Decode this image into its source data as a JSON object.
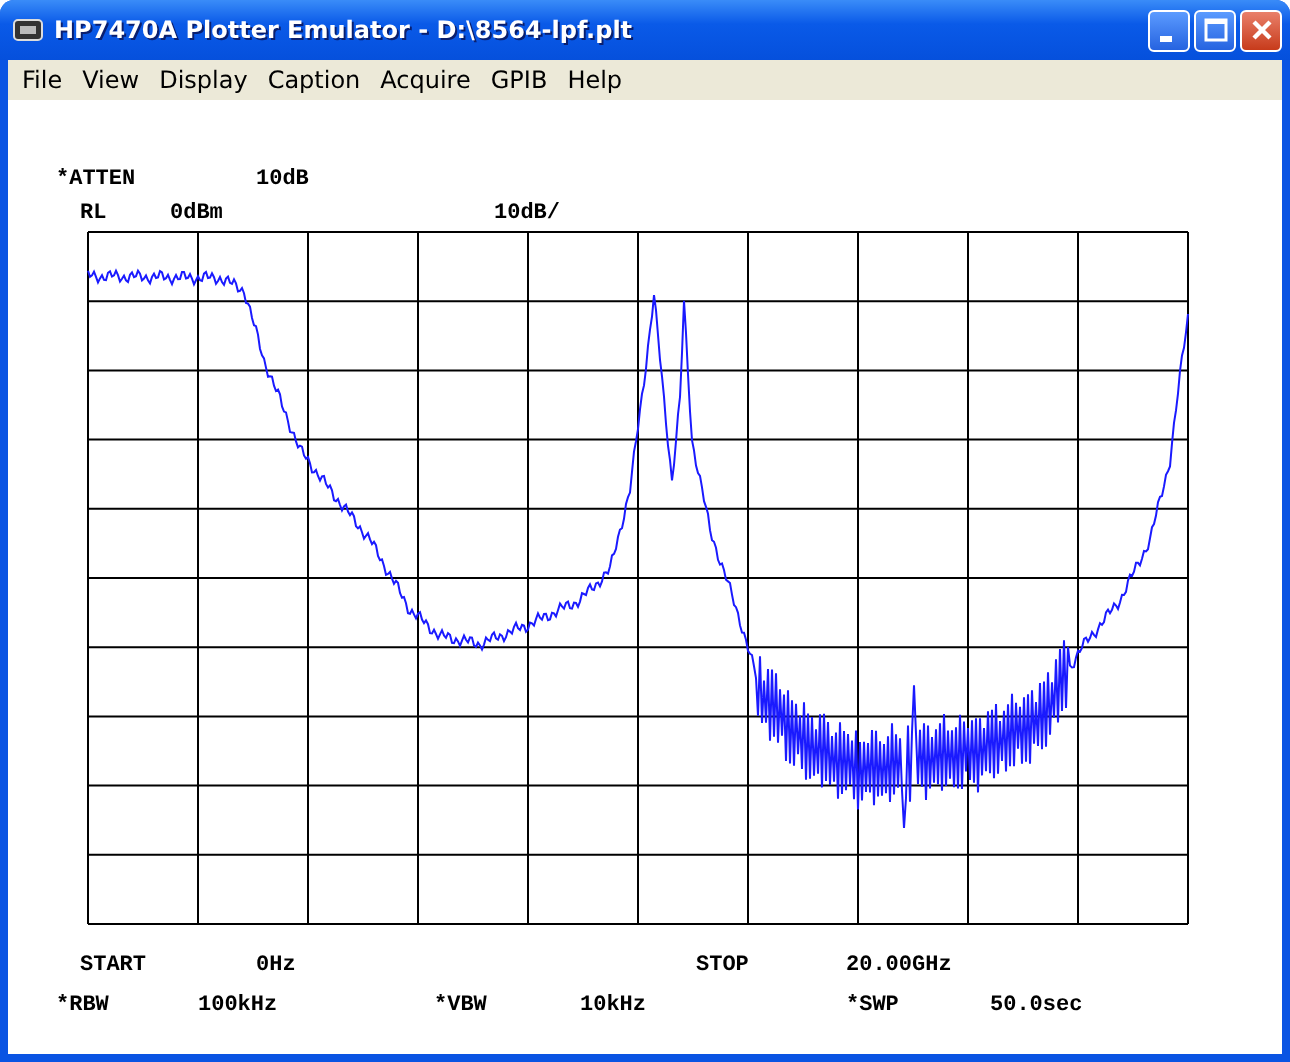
{
  "window": {
    "title": "HP7470A Plotter Emulator - D:\\8564-lpf.plt"
  },
  "menu": [
    "File",
    "View",
    "Display",
    "Caption",
    "Acquire",
    "GPIB",
    "Help"
  ],
  "header_lines": [
    [
      "*ATTEN",
      "10dB"
    ],
    [
      "RL",
      "0dBm",
      "10dB/"
    ]
  ],
  "footer_lines": [
    [
      "START",
      "0Hz",
      "STOP",
      "20.00GHz"
    ],
    [
      "*RBW",
      "100kHz",
      "*VBW",
      "10kHz",
      "*SWP",
      "50.0sec"
    ]
  ]
}
